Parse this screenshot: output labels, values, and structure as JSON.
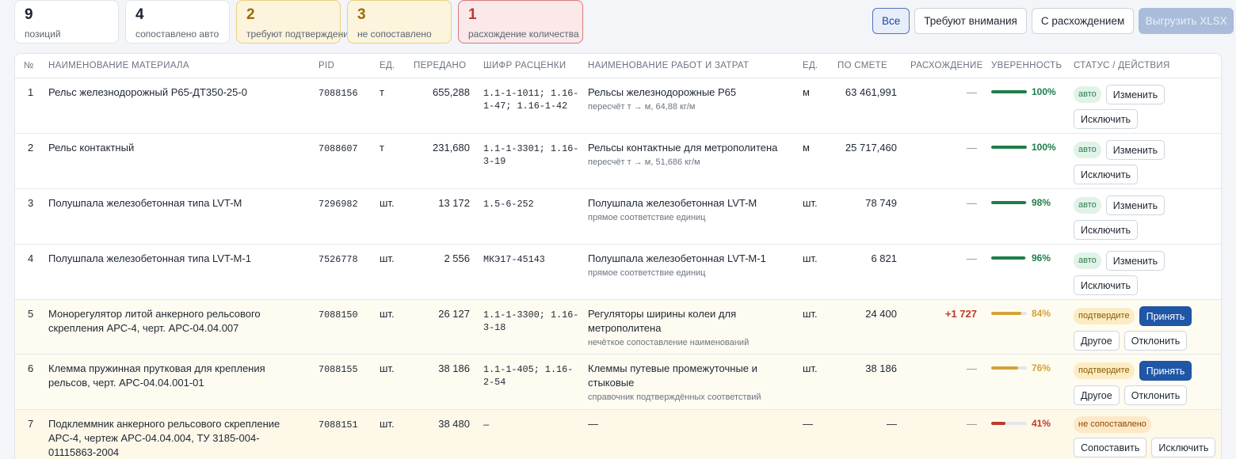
{
  "summary": [
    {
      "value": "9",
      "label": "позиций",
      "kind": "neutral"
    },
    {
      "value": "4",
      "label": "сопоставлено авто",
      "kind": "neutral"
    },
    {
      "value": "2",
      "label": "требуют подтверждения",
      "kind": "warn"
    },
    {
      "value": "3",
      "label": "не сопоставлено",
      "kind": "warn"
    },
    {
      "value": "1",
      "label": "расхождение количества",
      "kind": "danger"
    }
  ],
  "filters": {
    "all": "Все",
    "attention": "Требуют внимания",
    "discrepancy": "С расхождением",
    "export": "Выгрузить XLSX"
  },
  "columns": {
    "num": "№",
    "material": "Наименование материала",
    "pid": "PID",
    "unit": "Ед.",
    "transferred": "Передано",
    "code": "Шифр расценки",
    "work": "Наименование работ и затрат",
    "unit2": "Ед.",
    "estimate": "По смете",
    "diff": "Расхождение",
    "confidence": "Уверенность",
    "status": "Статус / действия"
  },
  "colors": {
    "high": "#1e7e4a",
    "mid": "#d4a236",
    "low": "#c0392b"
  },
  "rows": [
    {
      "n": "1",
      "material": "Рельс железнодорожный Р65-ДТ350-25-0",
      "pid": "7088156",
      "unit": "т",
      "transferred": "655,288",
      "code": "1.1-1-1011; 1.16-1-47; 1.16-1-42",
      "work": "Рельсы железнодорожные Р65",
      "work_note": "пересчёт т → м, 64,88 кг/м",
      "unit2": "м",
      "estimate": "63 461,991",
      "diff": "—",
      "confidence": 100,
      "confidence_label": "100%",
      "status": "авто",
      "actions": [
        "Изменить",
        "Исключить"
      ]
    },
    {
      "n": "2",
      "material": "Рельс контактный",
      "pid": "7088607",
      "unit": "т",
      "transferred": "231,680",
      "code": "1.1-1-3301; 1.16-3-19",
      "work": "Рельсы контактные для метрополитена",
      "work_note": "пересчёт т → м, 51,686 кг/м",
      "unit2": "м",
      "estimate": "25 717,460",
      "diff": "—",
      "confidence": 100,
      "confidence_label": "100%",
      "status": "авто",
      "actions": [
        "Изменить",
        "Исключить"
      ]
    },
    {
      "n": "3",
      "material": "Полушпала железобетонная типа LVT-M",
      "pid": "7296982",
      "unit": "шт.",
      "transferred": "13 172",
      "code": "1.5-6-252",
      "work": "Полушпала железобетонная LVT-M",
      "work_note": "прямое соответствие единиц",
      "unit2": "шт.",
      "estimate": "78 749",
      "diff": "—",
      "confidence": 98,
      "confidence_label": "98%",
      "status": "авто",
      "actions": [
        "Изменить",
        "Исключить"
      ]
    },
    {
      "n": "4",
      "material": "Полушпала железобетонная типа LVT-M-1",
      "pid": "7526778",
      "unit": "шт.",
      "transferred": "2 556",
      "code": "МКЭ17-45143",
      "work": "Полушпала железобетонная LVT-M-1",
      "work_note": "прямое соответствие единиц",
      "unit2": "шт.",
      "estimate": "6 821",
      "diff": "—",
      "confidence": 96,
      "confidence_label": "96%",
      "status": "авто",
      "actions": [
        "Изменить",
        "Исключить"
      ]
    },
    {
      "n": "5",
      "material": "Монорегулятор литой анкерного рельсового скрепления АРС-4, черт. АРС-04.04.007",
      "pid": "7088150",
      "unit": "шт.",
      "transferred": "26 127",
      "code": "1.1-1-3300; 1.16-3-18",
      "work": "Регуляторы ширины колеи для метрополитена",
      "work_note": "нечёткое сопоставление наименований",
      "unit2": "шт.",
      "estimate": "24 400",
      "diff": "+1 727",
      "confidence": 84,
      "confidence_label": "84%",
      "status": "подтвердите",
      "actions": [
        "Принять",
        "Другое",
        "Отклонить"
      ]
    },
    {
      "n": "6",
      "material": "Клемма пружинная прутковая для крепления рельсов, черт. АРС-04.04.001-01",
      "pid": "7088155",
      "unit": "шт.",
      "transferred": "38 186",
      "code": "1.1-1-405; 1.16-2-54",
      "work": "Клеммы путевые промежуточные и стыковые",
      "work_note": "справочник подтверждённых соответствий",
      "unit2": "шт.",
      "estimate": "38 186",
      "diff": "—",
      "confidence": 76,
      "confidence_label": "76%",
      "status": "подтвердите",
      "actions": [
        "Принять",
        "Другое",
        "Отклонить"
      ]
    },
    {
      "n": "7",
      "material": "Подклеммник анкерного рельсового скрепление АРС-4, чертеж АРС-04.04.004, ТУ 3185-004-01115863-2004",
      "pid": "7088151",
      "unit": "шт.",
      "transferred": "38 480",
      "code": "—",
      "work": "—",
      "work_note": "",
      "unit2": "—",
      "estimate": "—",
      "diff": "—",
      "confidence": 41,
      "confidence_label": "41%",
      "status": "не сопоставлено",
      "actions": [
        "Сопоставить",
        "Исключить"
      ]
    }
  ]
}
